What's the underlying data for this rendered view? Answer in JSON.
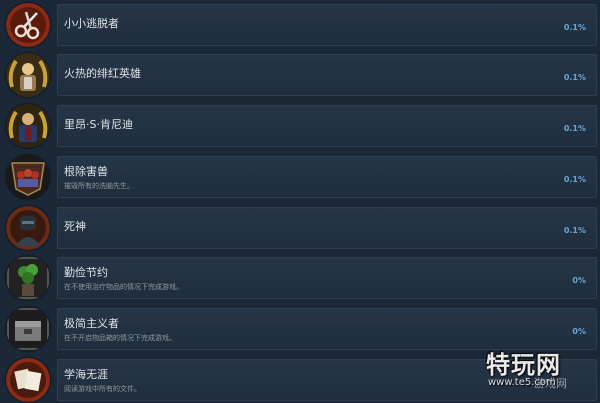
{
  "achievements": [
    {
      "title": "小小逃脱者",
      "description": "",
      "percent": "0.1%",
      "icon": "scissors-icon",
      "icon_color": "#8b2a15"
    },
    {
      "title": "火热的绯红英雄",
      "description": "",
      "percent": "0.1%",
      "icon": "hero-laurel-icon",
      "icon_color": "#c8a13a"
    },
    {
      "title": "里昂·S·肯尼迪",
      "description": "",
      "percent": "0.1%",
      "icon": "leon-laurel-icon",
      "icon_color": "#c8a13a"
    },
    {
      "title": "根除害兽",
      "description": "摧毁所有的洗脑先生。",
      "percent": "0.1%",
      "icon": "shield-figures-icon",
      "icon_color": "#4a2a1e"
    },
    {
      "title": "死神",
      "description": "",
      "percent": "0.1%",
      "icon": "soldier-icon",
      "icon_color": "#6b2b14"
    },
    {
      "title": "勤俭节约",
      "description": "在不使用治疗物品的情况下完成游戏。",
      "percent": "0%",
      "icon": "herb-icon",
      "icon_color": "#555555"
    },
    {
      "title": "极简主义者",
      "description": "在不开启物品箱的情况下完成游戏。",
      "percent": "0%",
      "icon": "item-box-icon",
      "icon_color": "#555555"
    },
    {
      "title": "学海无涯",
      "description": "阅读游戏中所有的文件。",
      "percent": "",
      "icon": "documents-icon",
      "icon_color": "#8b2a15"
    }
  ],
  "watermark": {
    "brand": "特玩网",
    "url": "www.te5.com",
    "sub": "游戏网"
  }
}
